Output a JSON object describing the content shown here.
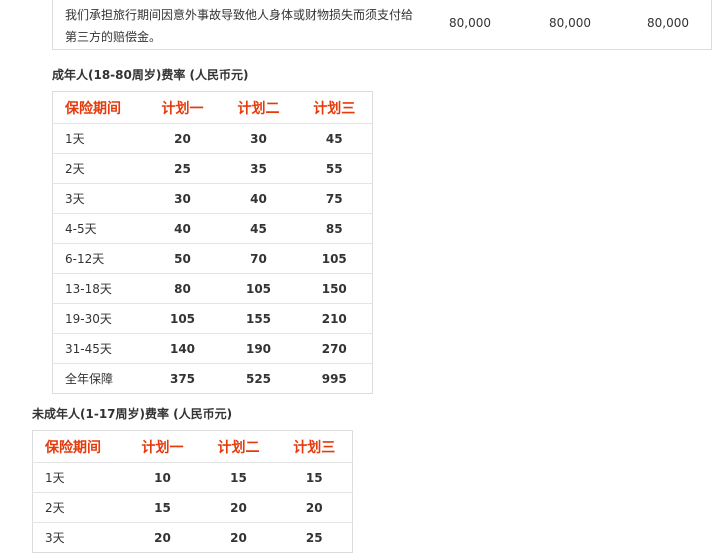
{
  "liability": {
    "desc_line1": "我们承担旅行期间因意外事故导致他人身体或财物损失而须支付给",
    "desc_line2": "第三方的赔偿金。",
    "amounts": [
      "80,000",
      "80,000",
      "80,000"
    ]
  },
  "adult": {
    "title": "成年人(18-80周岁)费率 (人民币元)",
    "headers": [
      "保险期间",
      "计划一",
      "计划二",
      "计划三"
    ],
    "rows": [
      [
        "1天",
        "20",
        "30",
        "45"
      ],
      [
        "2天",
        "25",
        "35",
        "55"
      ],
      [
        "3天",
        "30",
        "40",
        "75"
      ],
      [
        "4-5天",
        "40",
        "45",
        "85"
      ],
      [
        "6-12天",
        "50",
        "70",
        "105"
      ],
      [
        "13-18天",
        "80",
        "105",
        "150"
      ],
      [
        "19-30天",
        "105",
        "155",
        "210"
      ],
      [
        "31-45天",
        "140",
        "190",
        "270"
      ],
      [
        "全年保障",
        "375",
        "525",
        "995"
      ]
    ]
  },
  "minor": {
    "title": "未成年人(1-17周岁)费率 (人民币元)",
    "headers": [
      "保险期间",
      "计划一",
      "计划二",
      "计划三"
    ],
    "rows": [
      [
        "1天",
        "10",
        "15",
        "15"
      ],
      [
        "2天",
        "15",
        "20",
        "20"
      ],
      [
        "3天",
        "20",
        "20",
        "25"
      ]
    ]
  }
}
